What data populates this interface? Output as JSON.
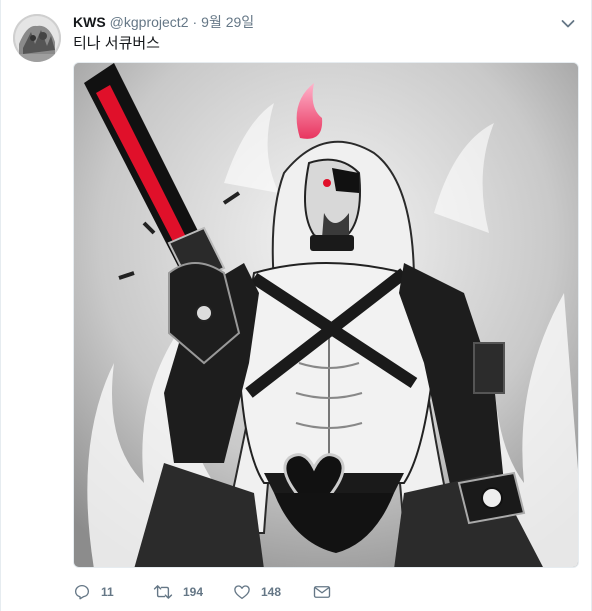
{
  "tweet": {
    "display_name": "KWS",
    "handle": "@kgproject2",
    "separator": "·",
    "date": "9월 29일",
    "text": "티나 서큐버스"
  },
  "icons": {
    "avatar": "avatar-image",
    "caret": "chevron-down-icon",
    "reply": "reply-icon",
    "retweet": "retweet-icon",
    "like": "heart-icon",
    "message": "envelope-icon"
  },
  "actions": {
    "reply_count": "11",
    "retweet_count": "194",
    "like_count": "148"
  },
  "colors": {
    "text_primary": "#14171a",
    "text_secondary": "#657786",
    "border": "#e6ecf0",
    "accent_red": "#e0102a",
    "accent_pink": "#ff6f9c"
  }
}
